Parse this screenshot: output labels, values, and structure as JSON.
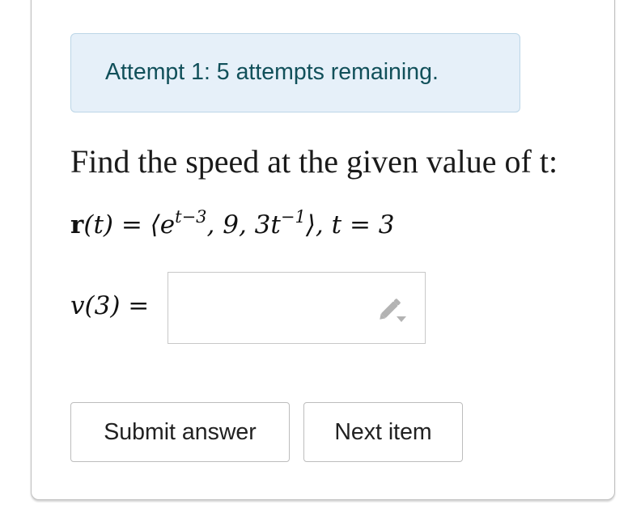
{
  "attempt": {
    "text": "Attempt 1: 5 attempts remaining."
  },
  "question": {
    "prompt": "Find the speed at the given value of t:",
    "equation": {
      "lhs_bold": "r",
      "lhs_rest": "(t) = ⟨e",
      "exp1": "t−3",
      "mid": ", 9, 3t",
      "exp2": "−1",
      "rhs": "⟩, t = 3"
    },
    "answer_label": "v(3) ="
  },
  "answer": {
    "value": "",
    "icon": "pencil-icon"
  },
  "buttons": {
    "submit_label": "Submit answer",
    "next_label": "Next item"
  }
}
